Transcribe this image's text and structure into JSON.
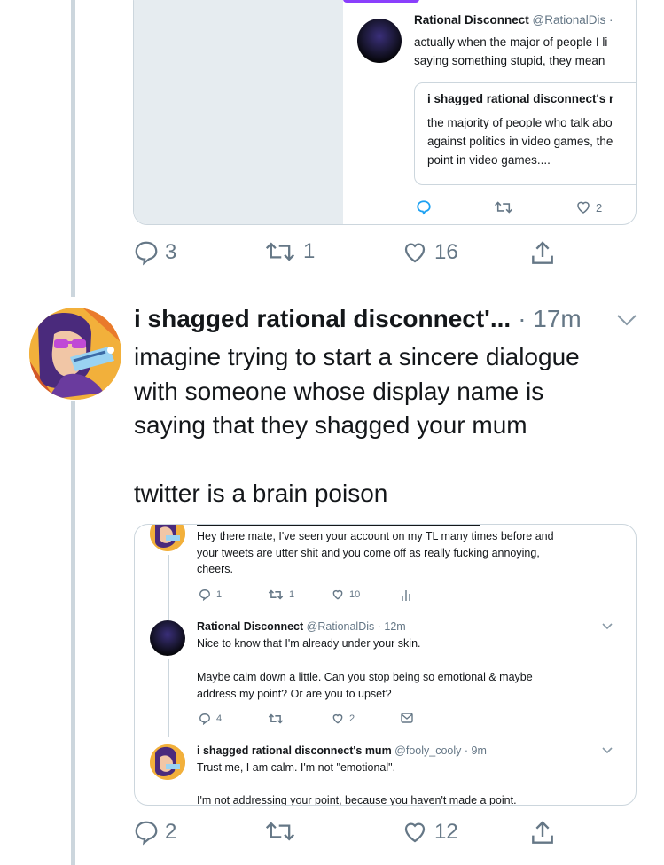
{
  "quoted_card": {
    "author_name": "Rational Disconnect",
    "author_handle": "@RationalDis ·",
    "text_lines": [
      "actually when the major of people I li",
      "saying something stupid, they mean"
    ],
    "quote_title": "i shagged rational disconnect's r",
    "quote_lines": [
      "the majority of people who talk abo",
      "against politics in video games, the",
      "point in video games...."
    ],
    "reply_count": "",
    "retweet_count": "",
    "like_count": "2"
  },
  "top_actions": {
    "reply_count": "3",
    "retweet_count": "1",
    "like_count": "16"
  },
  "tweet": {
    "author_name": "i shagged rational disconnect'...",
    "time": "· 17m",
    "text": "imagine trying to start a sincere dialogue\nwith someone whose display name is\nsaying that they shagged your mum\n\ntwitter is a brain poison"
  },
  "screenshot": {
    "first_reply_lines": [
      "Hey there mate, I've seen your account on my TL many times before and",
      "your tweets are utter shit and you come off as really fucking annoying,",
      "cheers."
    ],
    "first_actions": {
      "reply": "1",
      "retweet": "1",
      "like": "10"
    },
    "second": {
      "name": "Rational Disconnect",
      "meta": "@RationalDis · 12m",
      "line1": "Nice to know that I'm already under your skin.",
      "line2": "Maybe calm down a little. Can you stop being so emotional & maybe",
      "line3": "address my point? Or are you to upset?",
      "actions": {
        "reply": "4",
        "retweet": "",
        "like": "2"
      }
    },
    "third": {
      "name": "i shagged rational disconnect's mum",
      "meta": "@fooly_cooly · 9m",
      "line1": "Trust me, I am calm. I'm not \"emotional\".",
      "line2": "I'm not addressing your point, because you haven't made a point."
    }
  },
  "bottom_actions": {
    "reply_count": "2",
    "retweet_count": "",
    "like_count": "12"
  },
  "colors": {
    "text": "#14171a",
    "muted": "#657786",
    "border": "#ccd6dd",
    "accent": "#8a3ffc"
  }
}
